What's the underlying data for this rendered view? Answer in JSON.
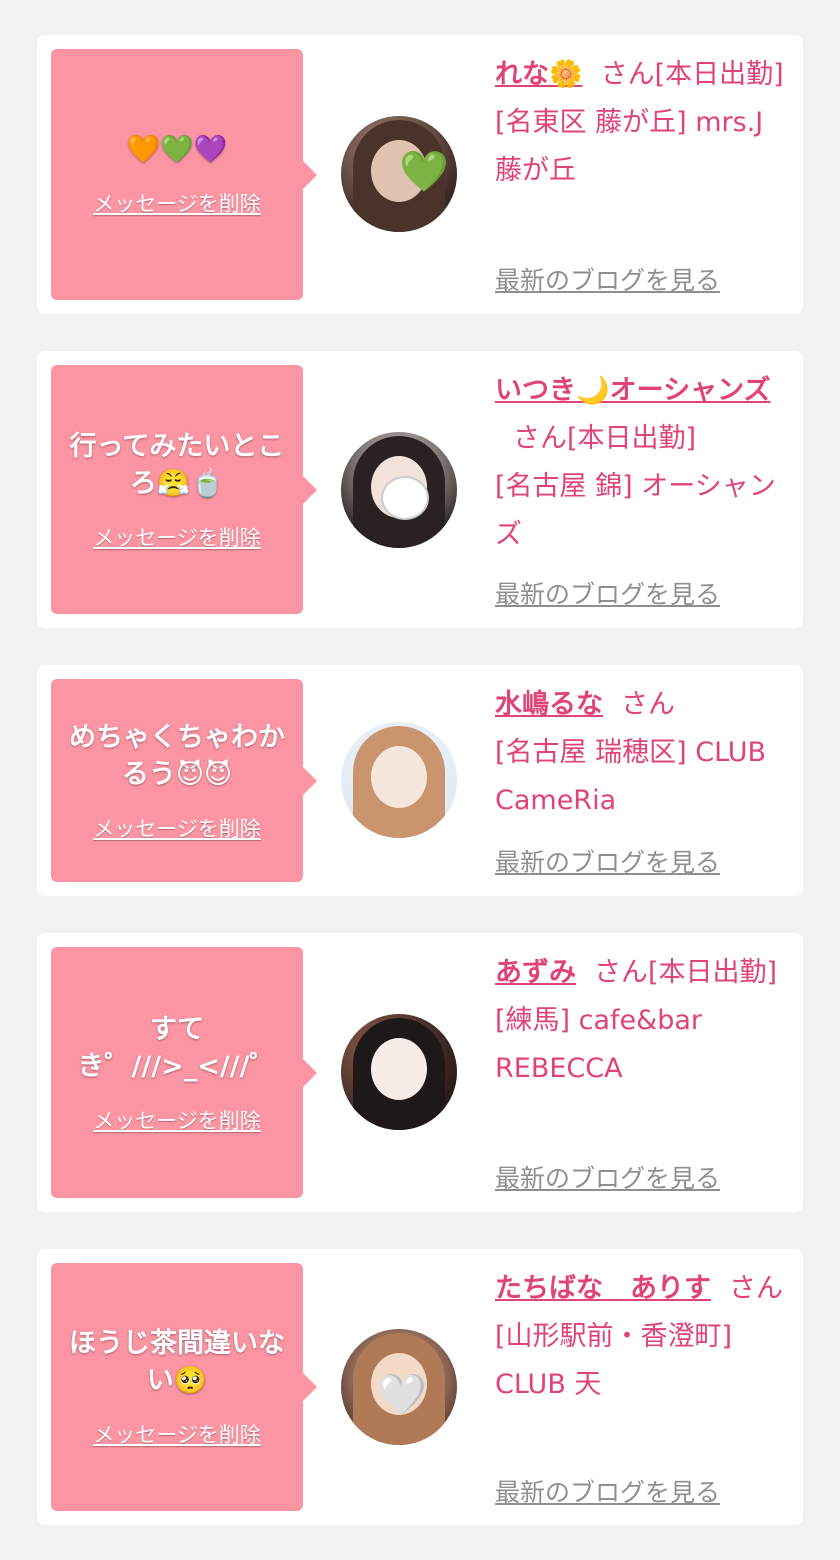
{
  "messages": [
    {
      "text": "🧡💚💜",
      "delete_label": "メッセージを削除",
      "name": "れな🌼",
      "suffix": "さん[本日出勤]",
      "shop": "[名東区 藤が丘] mrs.J 藤が丘",
      "blog_label": "最新のブログを見る",
      "avatar_sticker": "💚"
    },
    {
      "text": "行ってみたいところ😤🍵",
      "delete_label": "メッセージを削除",
      "name": "いつき🌙オーシャンズ",
      "suffix": "さん[本日出勤]",
      "shop": "[名古屋 錦] オーシャンズ",
      "blog_label": "最新のブログを見る",
      "avatar_sticker": ""
    },
    {
      "text": "めちゃくちゃわかるう😈😈",
      "delete_label": "メッセージを削除",
      "name": "水嶋るな",
      "suffix": "さん",
      "shop": "[名古屋 瑞穂区] CLUB CameRia",
      "blog_label": "最新のブログを見る",
      "avatar_sticker": ""
    },
    {
      "text": "すてき゜///>_<///゜",
      "delete_label": "メッセージを削除",
      "name": "あずみ",
      "suffix": "さん[本日出勤]",
      "shop": "[練馬] cafe&bar REBECCA",
      "blog_label": "最新のブログを見る",
      "avatar_sticker": ""
    },
    {
      "text": "ほうじ茶間違いない🥺",
      "delete_label": "メッセージを削除",
      "name": "たちばな　ありす",
      "suffix": "さん",
      "shop": "[山形駅前・香澄町] CLUB 天",
      "blog_label": "最新のブログを見る",
      "avatar_sticker": "🤍"
    }
  ],
  "colors": {
    "bubble": "#fc95a3",
    "name_link": "#e04378",
    "blog_link": "#8f8f8f",
    "background": "#f2f2f2"
  }
}
